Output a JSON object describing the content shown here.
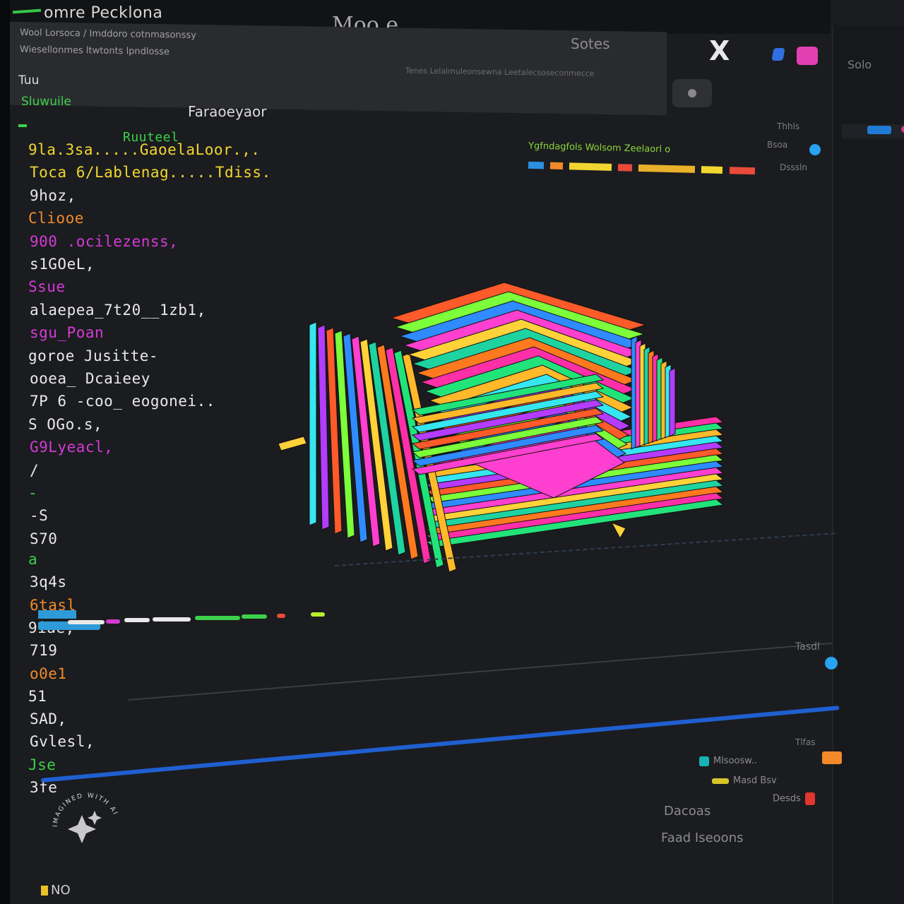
{
  "window": {
    "app_title": "omre Pecklona",
    "center_title": "Moo e",
    "menu_label": "Sotes",
    "close_glyph": "X"
  },
  "banner": {
    "line1": "Wool Lorsoca / Imddoro cotnmasonssy",
    "line2": "Wiesellonmes ltwtonts lpndlosse",
    "faint_text": "Tenes Lelalmuleonsewna Leetalecsoseconmecce"
  },
  "subheader": {
    "label_left": "Tuu",
    "label_left_2": "Sluwuile",
    "label_center": "Faraoeyaor"
  },
  "code": {
    "header": "Ruuteel",
    "lines": [
      {
        "text": "9la.3sa.....GaoelaLoor.,.",
        "color": "#f2d630"
      },
      {
        "text": "Toca 6/Lablenag.....Tdiss.",
        "color": "#f2d630"
      },
      {
        "text": "9hoz,",
        "color": "#e9e9e9"
      },
      {
        "text": "Cliooe",
        "color": "#f28a2a"
      },
      {
        "text": "900  .ocilezenss,",
        "color": "#d43ad8"
      },
      {
        "text": "s1GOeL,",
        "color": "#e9e9e9"
      },
      {
        "text": "Ssue",
        "color": "#d43ad8"
      },
      {
        "text": "alaepea_7t20__1zb1,",
        "color": "#e9e9e9"
      },
      {
        "text": "sgu_Poan",
        "color": "#d43ad8"
      },
      {
        "text": "goroe Jusitte-",
        "color": "#e9e9e9"
      },
      {
        "text": "ooea_ Dcaieey",
        "color": "#e9e9e9"
      },
      {
        "text": "7P 6 -coo_ eogonei..",
        "color": "#e9e9e9"
      },
      {
        "text": "S  OGo.s,",
        "color": "#e9e9e9"
      },
      {
        "text": "G9Lyeacl,",
        "color": "#d43ad8"
      },
      {
        "text": "/",
        "color": "#e9e9e9"
      },
      {
        "text": "-",
        "color": "#3bd14a"
      },
      {
        "text": "-S",
        "color": "#e9e9e9"
      },
      {
        "text": "S70",
        "color": "#e9e9e9"
      }
    ],
    "lines_lower": [
      {
        "text": "a",
        "color": "#3bd14a"
      },
      {
        "text": "3q4s",
        "color": "#e9e9e9"
      },
      {
        "text": "6tasl",
        "color": "#f28a2a"
      },
      {
        "text": "9iae,",
        "color": "#e9e9e9"
      },
      {
        "text": "719",
        "color": "#e9e9e9"
      },
      {
        "text": "o0e1",
        "color": "#f28a2a"
      },
      {
        "text": "51",
        "color": "#e9e9e9"
      },
      {
        "text": "SAD,",
        "color": "#e9e9e9"
      },
      {
        "text": "Gvlesl,",
        "color": "#e9e9e9"
      },
      {
        "text": "Jse",
        "color": "#3bd14a"
      },
      {
        "text": "3fe",
        "color": "#e9e9e9"
      }
    ]
  },
  "syntax_row": {
    "row1_text": "Ygfndagfols Wolsom Zeelaorl o"
  },
  "right_panel": {
    "label_top": "Solo",
    "stat1": "Thhls",
    "stat2": "Bsoa",
    "stat3": "Tlfas",
    "stat4": "Tasdl",
    "stat5": "Dsssln"
  },
  "legend": {
    "row1": "Mlsoosw..",
    "row2": "Masd Bsv",
    "row3": "Desds"
  },
  "footer": {
    "label1": "Dacoas",
    "label2": "Faad Iseoons"
  },
  "watermark": {
    "text": "IMAGINED WITH AI"
  },
  "bottom_tag": "NO",
  "colors": {
    "accent_green": "#3bd14a",
    "accent_blue": "#1f5fd0",
    "accent_pink": "#e23fb3",
    "background": "#1b1c1f"
  },
  "icons": {
    "close": "close-icon",
    "sparkle": "sparkle-icon"
  }
}
